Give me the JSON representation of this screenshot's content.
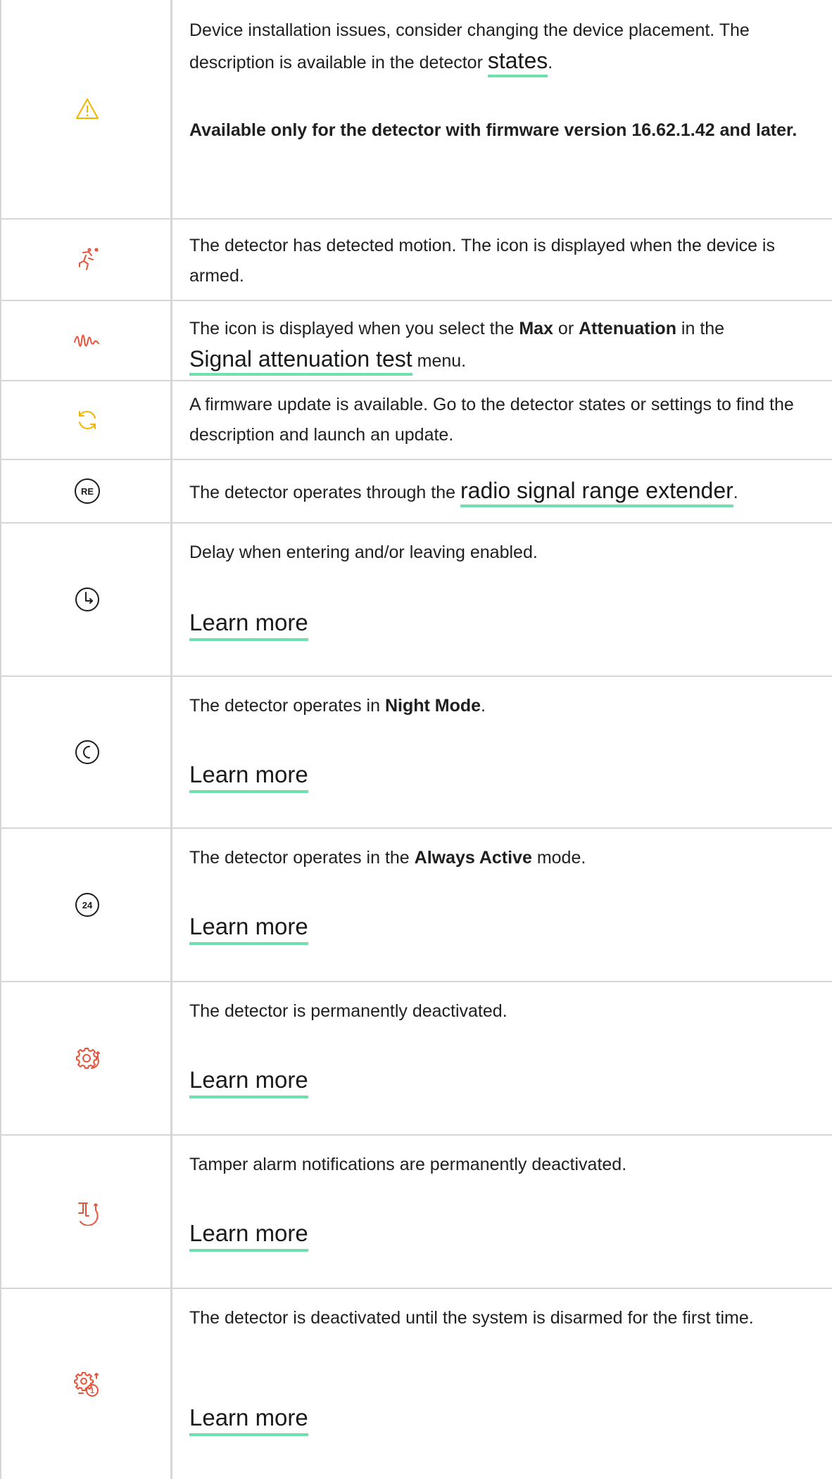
{
  "colors": {
    "warning": "#f5b400",
    "alert": "#e8543b",
    "neutral": "#1d1d1d",
    "link_underline": "#6ee0ab",
    "border": "#d6d6d6"
  },
  "rows": [
    {
      "icon": "warning-triangle-icon",
      "text_a": "Device installation issues, consider changing the device placement. The description is available in the detector ",
      "link": "states",
      "text_b": ".",
      "note": "Available only for the detector with firmware version 16.62.1.42 and later."
    },
    {
      "icon": "motion-detected-icon",
      "text": "The detector has detected motion. The icon is displayed when the device is armed."
    },
    {
      "icon": "signal-wave-icon",
      "text_a": "The icon is displayed when you select the ",
      "bold_1": "Max",
      "text_or": " or ",
      "bold_2": "Attenuation",
      "text_in": " in the",
      "link": "Signal attenuation test",
      "text_b": " menu."
    },
    {
      "icon": "firmware-update-icon",
      "text": "A firmware update is available. Go to the detector states or settings to find the description and launch an update."
    },
    {
      "icon": "range-extender-icon",
      "icon_label": "RE",
      "text_a": "The detector operates through the ",
      "link": "radio signal range extender",
      "text_b": "."
    },
    {
      "icon": "delay-clock-icon",
      "text": "Delay when entering and/or leaving enabled.",
      "learn": "Learn more"
    },
    {
      "icon": "night-mode-icon",
      "text_a": "The detector operates in ",
      "bold_1": "Night Mode",
      "text_b": ".",
      "learn": "Learn more"
    },
    {
      "icon": "always-active-icon",
      "icon_label": "24",
      "text_a": "The detector operates in the ",
      "bold_1": "Always Active",
      "text_b": " mode.",
      "learn": "Learn more"
    },
    {
      "icon": "permanently-deactivated-icon",
      "text": "The detector is permanently deactivated.",
      "learn": "Learn more"
    },
    {
      "icon": "tamper-deactivated-icon",
      "text": "Tamper alarm notifications are permanently deactivated.",
      "learn": "Learn more"
    },
    {
      "icon": "deactivated-until-disarm-icon",
      "icon_label": "1",
      "text": "The detector is deactivated until the system is disarmed for the first time.",
      "learn": "Learn more"
    }
  ]
}
